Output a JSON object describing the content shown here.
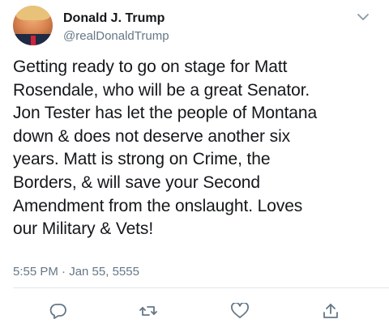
{
  "tweet": {
    "display_name": "Donald J. Trump",
    "handle": "@realDonaldTrump",
    "text": "Getting ready to go on stage for Matt\nRosendale, who will be a great Senator.\nJon Tester has let the people of Montana\ndown & does not deserve another six\nyears. Matt is strong on Crime, the\nBorders, & will save your Second\nAmendment from the onslaught. Loves\nour Military & Vets!",
    "timestamp": "5:55 PM · Jan 55, 5555"
  },
  "icons": {
    "menu": "chevron-down-icon",
    "reply": "reply-icon",
    "retweet": "retweet-icon",
    "like": "like-icon",
    "share": "share-icon"
  },
  "colors": {
    "text": "#14171a",
    "secondary": "#657786",
    "divider": "#e1e8ed"
  }
}
